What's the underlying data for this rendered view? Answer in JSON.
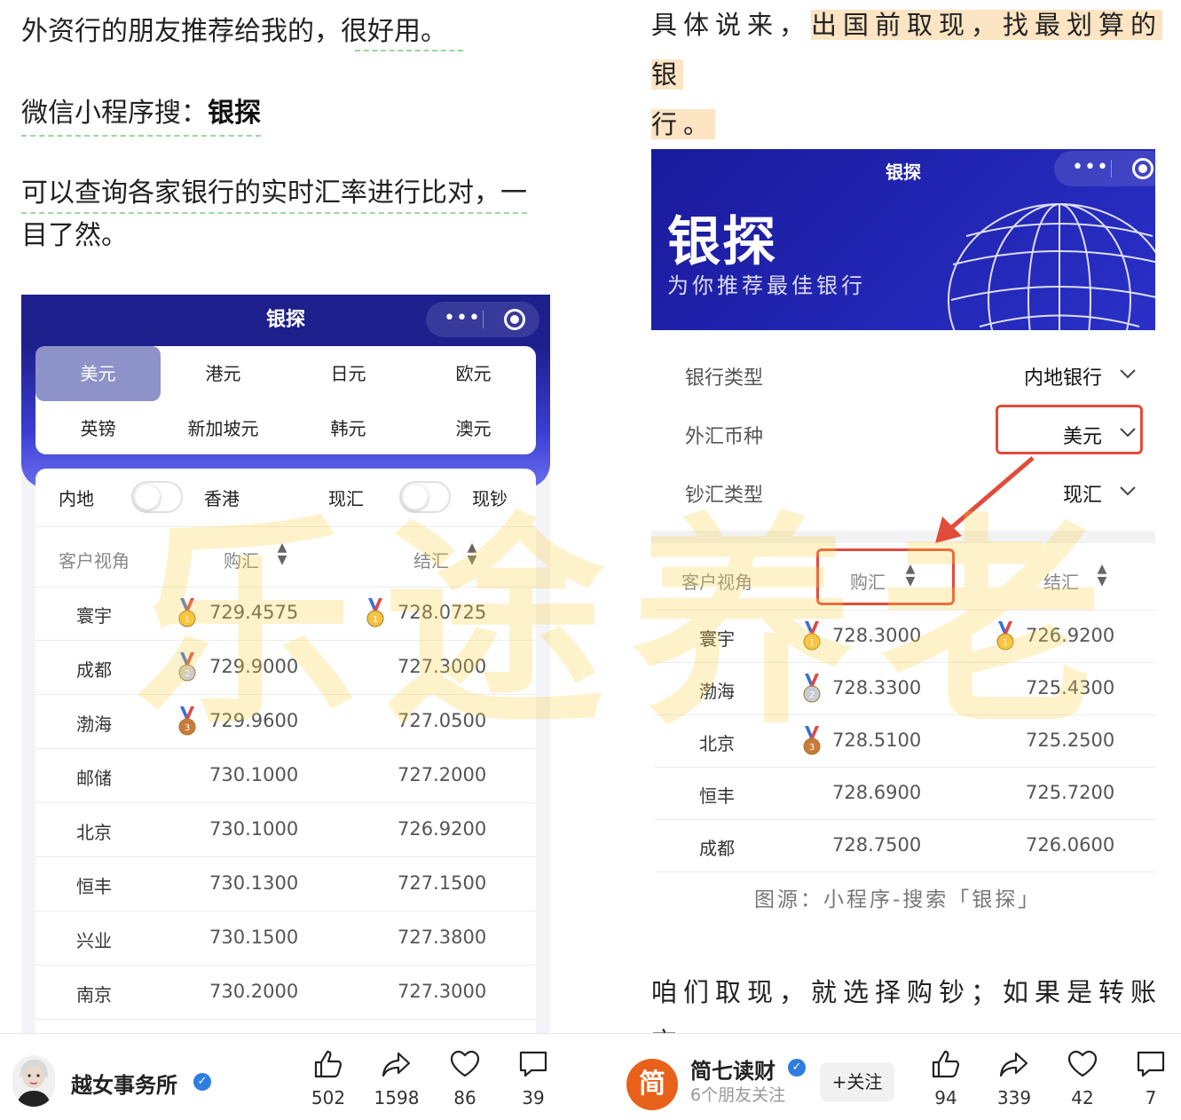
{
  "left": {
    "paragraphs": [
      "外资行的朋友推荐给我的，很好用。",
      "微信小程序搜：",
      "可以查询各家银行的实时汇率进行比对，一",
      "目了然。"
    ],
    "search_keyword": "银探",
    "app_title": "银探",
    "currencies": [
      "美元",
      "港元",
      "日元",
      "欧元",
      "英镑",
      "新加坡元",
      "韩元",
      "澳元"
    ],
    "active_currency": "美元",
    "toggles": {
      "inland": "内地",
      "hongkong": "香港",
      "spot": "现汇",
      "cash": "现钞"
    },
    "headers": {
      "view": "客户视角",
      "buy": "购汇",
      "sell": "结汇"
    },
    "rows": [
      {
        "bank": "寰宇",
        "buy": "729.4575",
        "sell": "728.0725",
        "buy_medal": "gold",
        "sell_medal": "gold"
      },
      {
        "bank": "成都",
        "buy": "729.9000",
        "sell": "727.3000",
        "buy_medal": "silver",
        "sell_medal": ""
      },
      {
        "bank": "渤海",
        "buy": "729.9600",
        "sell": "727.0500",
        "buy_medal": "bronze",
        "sell_medal": ""
      },
      {
        "bank": "邮储",
        "buy": "730.1000",
        "sell": "727.2000",
        "buy_medal": "",
        "sell_medal": ""
      },
      {
        "bank": "北京",
        "buy": "730.1000",
        "sell": "726.9200",
        "buy_medal": "",
        "sell_medal": ""
      },
      {
        "bank": "恒丰",
        "buy": "730.1300",
        "sell": "727.1500",
        "buy_medal": "",
        "sell_medal": ""
      },
      {
        "bank": "兴业",
        "buy": "730.1500",
        "sell": "727.3800",
        "buy_medal": "",
        "sell_medal": ""
      },
      {
        "bank": "南京",
        "buy": "730.2000",
        "sell": "727.3000",
        "buy_medal": "",
        "sell_medal": ""
      }
    ],
    "footer": {
      "author": "越女事务所",
      "likes": "502",
      "shares": "1598",
      "favorites": "86",
      "comments": "39"
    }
  },
  "right": {
    "intro_plain": "具体说来，",
    "intro_highlight_1": "出国前取现，找最划算的银",
    "intro_highlight_2": "行。",
    "app_title": "银探",
    "brand": "银探",
    "slogan": "为你推荐最佳银行",
    "form": [
      {
        "label": "银行类型",
        "value": "内地银行"
      },
      {
        "label": "外汇币种",
        "value": "美元"
      },
      {
        "label": "钞汇类型",
        "value": "现汇"
      }
    ],
    "headers": {
      "view": "客户视角",
      "buy": "购汇",
      "sell": "结汇"
    },
    "rows": [
      {
        "bank": "寰宇",
        "buy": "728.3000",
        "sell": "726.9200",
        "buy_medal": "gold",
        "sell_medal": "gold"
      },
      {
        "bank": "渤海",
        "buy": "728.3300",
        "sell": "725.4300",
        "buy_medal": "silver",
        "sell_medal": ""
      },
      {
        "bank": "北京",
        "buy": "728.5100",
        "sell": "725.2500",
        "buy_medal": "bronze",
        "sell_medal": ""
      },
      {
        "bank": "恒丰",
        "buy": "728.6900",
        "sell": "725.7200",
        "buy_medal": "",
        "sell_medal": ""
      },
      {
        "bank": "成都",
        "buy": "728.7500",
        "sell": "726.0600",
        "buy_medal": "",
        "sell_medal": ""
      }
    ],
    "caption": "图源：小程序-搜索「银探」",
    "bottom_text": "咱们取现，就选择购钞；如果是转账交",
    "footer": {
      "author": "简七读财",
      "friends": "6个朋友关注",
      "follow": "+关注",
      "avatar_text": "简",
      "likes": "94",
      "shares": "339",
      "favorites": "42",
      "comments": "7"
    }
  },
  "watermark": "乐途养老",
  "colors": {
    "nav_blue": "#1c1f8c",
    "accent_red": "#e24b3a",
    "highlight": "#fde4c3",
    "gold": "#f5c242",
    "silver": "#c7ccd6",
    "bronze": "#c97a3a"
  }
}
